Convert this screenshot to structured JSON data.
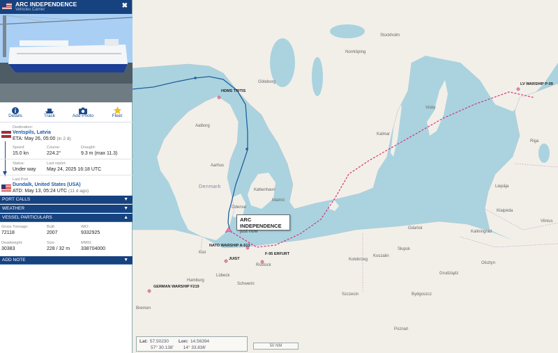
{
  "vessel": {
    "name": "ARC INDEPENDENCE",
    "type": "Vehicles Carrier",
    "flag": "us-flag"
  },
  "actions": [
    {
      "label": "Details",
      "icon": "info-icon"
    },
    {
      "label": "Track",
      "icon": "ship-icon"
    },
    {
      "label": "Add Photo",
      "icon": "camera-icon"
    },
    {
      "label": "Fleet",
      "icon": "star-icon"
    }
  ],
  "voyage": {
    "destination_label": "Destination:",
    "destination": "Ventspils, Latvia",
    "eta_label": "ETA:",
    "eta": "May 26, 05:00",
    "eta_relative": "(in 2 d)",
    "speed_label": "Speed:",
    "speed": "15.0 kn",
    "course_label": "Course:",
    "course": "224.2°",
    "draught_label": "Draught:",
    "draught": "9.3 m (max 11.3)",
    "status_label": "Status:",
    "status": "Under way",
    "last_report_label": "Last report:",
    "last_report": "May 24, 2025 16:18 UTC",
    "last_port_label": "Last Port",
    "last_port": "Dundalk, United States (USA)",
    "atd_label": "ATD:",
    "atd": "May 13, 05:24 UTC",
    "atd_relative": "(11 d ago)"
  },
  "sections": {
    "port_calls": "PORT CALLS",
    "weather": "WEATHER",
    "vessel_particulars": "VESSEL PARTICULARS",
    "add_note": "ADD NOTE"
  },
  "particulars": {
    "gross_tonnage_label": "Gross Tonnage:",
    "gross_tonnage": "72118",
    "built_label": "Built:",
    "built": "2007",
    "imo_label": "IMO:",
    "imo": "9332925",
    "deadweight_label": "Deadweight:",
    "deadweight": "30383",
    "size_label": "Size:",
    "size": "228 / 32 m",
    "mmsi_label": "MMSI:",
    "mmsi": "338704000"
  },
  "map": {
    "callout_name": "ARC INDEPENDENCE",
    "callout_time": "just now",
    "ships": [
      {
        "name": "HDMS TRITIS"
      },
      {
        "name": "LV WARSHIP P-09"
      },
      {
        "name": "NATO WARSHIP A-513"
      },
      {
        "name": "F-95 ERFURT"
      },
      {
        "name": "JUIST"
      },
      {
        "name": "GERMAN WARSHIP F219"
      }
    ],
    "countries": [
      "Denmark"
    ],
    "cities": [
      "Göteborg",
      "Stockholm",
      "Norrköping",
      "Kalmar",
      "Malmö",
      "København",
      "Aalborg",
      "Aarhus",
      "Odense",
      "Kiel",
      "Hamburg",
      "Lübeck",
      "Rostock",
      "Szczecin",
      "Gdańsk",
      "Kaliningrad",
      "Klaipėda",
      "Liepāja",
      "Riga",
      "Visby",
      "Bremen",
      "Poznań",
      "Bydgoszcz",
      "Olsztyn",
      "Grudziądz",
      "Słupsk",
      "Kołobrzeg",
      "Koszalin",
      "Schwerin",
      "Vilnius"
    ],
    "lat_label": "Lat:",
    "lat_dec": "57.50230",
    "lat_dms": "57° 30.138'",
    "lon_label": "Lon:",
    "lon_dec": "14.56394",
    "lon_dms": "14° 33.836'",
    "scale": "50 NM"
  },
  "colors": {
    "sea": "#aad3df",
    "land": "#f2efe9",
    "header": "#16427f",
    "past_track": "#1f5f9a",
    "planned_route": "#d6337a"
  }
}
